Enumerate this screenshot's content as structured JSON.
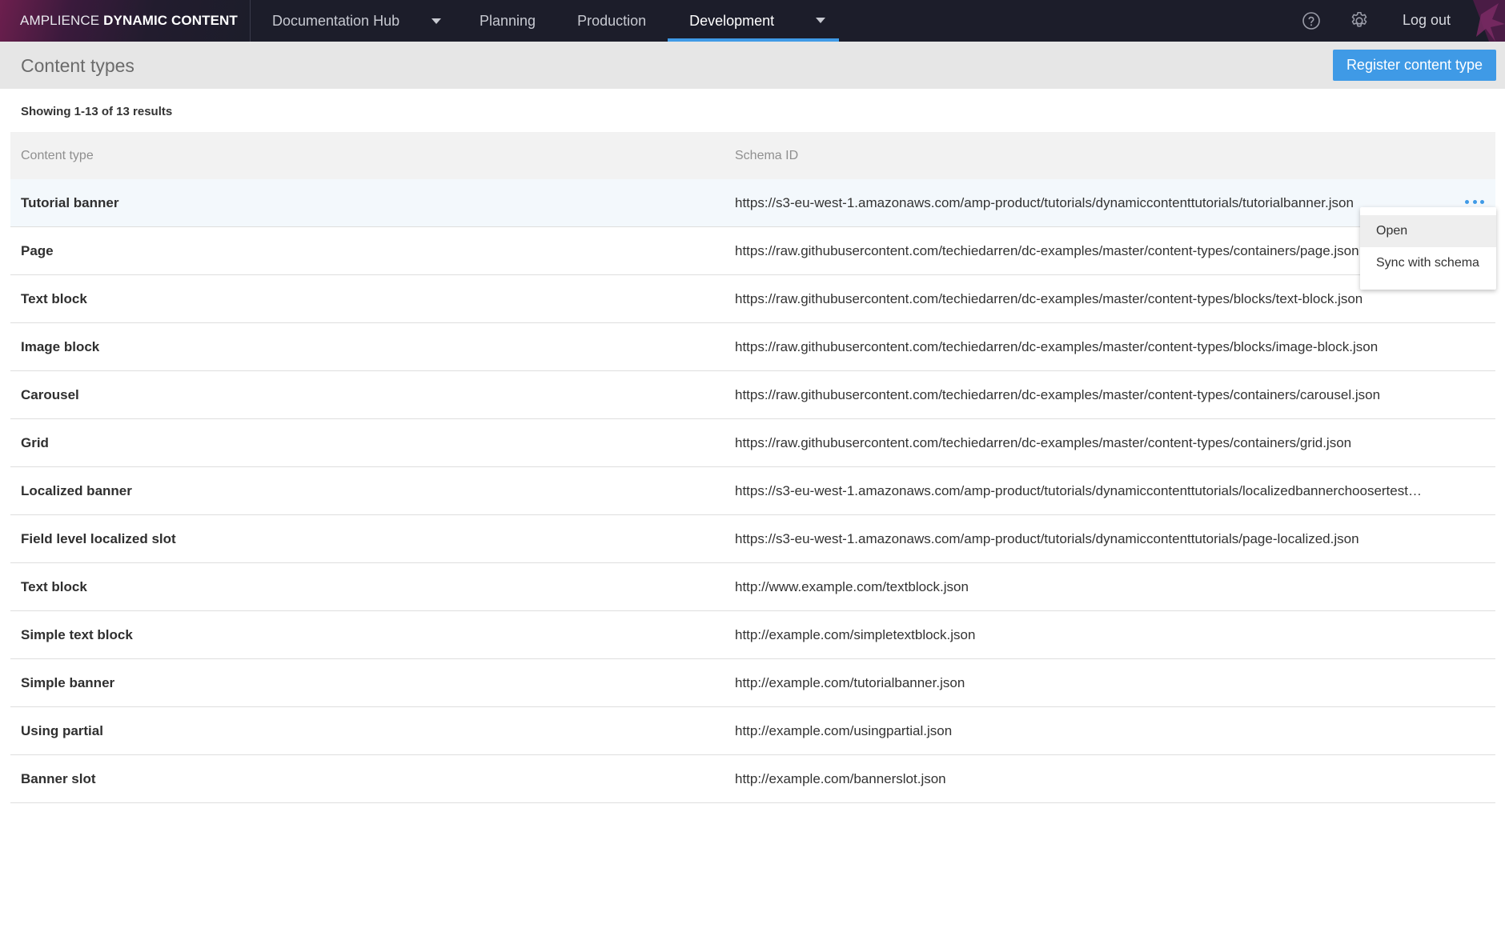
{
  "app": {
    "brand_light": "AMPLIENCE",
    "brand_strong": "DYNAMIC CONTENT"
  },
  "nav": {
    "hub": "Documentation Hub",
    "items": [
      {
        "label": "Planning"
      },
      {
        "label": "Production"
      },
      {
        "label": "Development",
        "active": true
      }
    ],
    "logout": "Log out",
    "icons": [
      "help-icon",
      "gear-icon"
    ]
  },
  "header": {
    "title": "Content types",
    "register_button": "Register content type"
  },
  "results_text": "Showing 1-13 of 13 results",
  "table": {
    "columns": [
      "Content type",
      "Schema ID"
    ],
    "rows": [
      {
        "name": "Tutorial banner",
        "schema": "https://s3-eu-west-1.amazonaws.com/amp-product/tutorials/dynamiccontenttutorials/tutorialbanner.json"
      },
      {
        "name": "Page",
        "schema": "https://raw.githubusercontent.com/techiedarren/dc-examples/master/content-types/containers/page.json"
      },
      {
        "name": "Text block",
        "schema": "https://raw.githubusercontent.com/techiedarren/dc-examples/master/content-types/blocks/text-block.json"
      },
      {
        "name": "Image block",
        "schema": "https://raw.githubusercontent.com/techiedarren/dc-examples/master/content-types/blocks/image-block.json"
      },
      {
        "name": "Carousel",
        "schema": "https://raw.githubusercontent.com/techiedarren/dc-examples/master/content-types/containers/carousel.json"
      },
      {
        "name": "Grid",
        "schema": "https://raw.githubusercontent.com/techiedarren/dc-examples/master/content-types/containers/grid.json"
      },
      {
        "name": "Localized banner",
        "schema": "https://s3-eu-west-1.amazonaws.com/amp-product/tutorials/dynamiccontenttutorials/localizedbannerchoosertest…"
      },
      {
        "name": "Field level localized slot",
        "schema": "https://s3-eu-west-1.amazonaws.com/amp-product/tutorials/dynamiccontenttutorials/page-localized.json"
      },
      {
        "name": "Text block",
        "schema": "http://www.example.com/textblock.json"
      },
      {
        "name": "Simple text block",
        "schema": "http://example.com/simpletextblock.json"
      },
      {
        "name": "Simple banner",
        "schema": "http://example.com/tutorialbanner.json"
      },
      {
        "name": "Using partial",
        "schema": "http://example.com/usingpartial.json"
      },
      {
        "name": "Banner slot",
        "schema": "http://example.com/bannerslot.json"
      }
    ]
  },
  "context_menu": {
    "items": [
      "Open",
      "Sync with schema"
    ]
  },
  "colors": {
    "accent": "#3f9ae6",
    "topbar": "#1c1d2a",
    "header_bg": "#e6e6e6"
  }
}
